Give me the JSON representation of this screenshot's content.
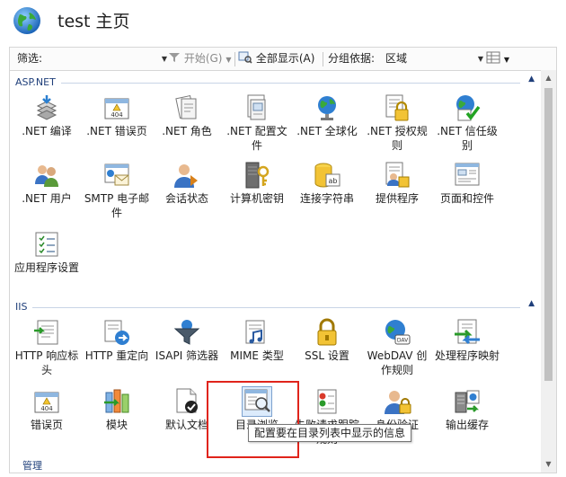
{
  "title": "test 主页",
  "filter": {
    "label": "筛选:",
    "value": "",
    "start_label": "开始(G)",
    "show_all_label": "全部显示(A)",
    "group_by_label": "分组依据:",
    "group_by_value": "区域"
  },
  "groups": [
    {
      "name": "ASP.NET",
      "items": [
        {
          "label": ".NET 编译",
          "icon": "compile-icon"
        },
        {
          "label": ".NET 错误页",
          "icon": "error-page-404-icon"
        },
        {
          "label": ".NET 角色",
          "icon": "roles-icon"
        },
        {
          "label": ".NET 配置文件",
          "icon": "profile-icon"
        },
        {
          "label": ".NET 全球化",
          "icon": "globalization-icon"
        },
        {
          "label": ".NET 授权规则",
          "icon": "authorization-lock-icon"
        },
        {
          "label": ".NET 信任级别",
          "icon": "trust-level-icon"
        },
        {
          "label": ".NET 用户",
          "icon": "users-icon"
        },
        {
          "label": "SMTP 电子邮件",
          "icon": "smtp-email-icon"
        },
        {
          "label": "会话状态",
          "icon": "session-state-icon"
        },
        {
          "label": "计算机密钥",
          "icon": "machine-key-icon"
        },
        {
          "label": "连接字符串",
          "icon": "connection-string-icon"
        },
        {
          "label": "提供程序",
          "icon": "providers-icon"
        },
        {
          "label": "页面和控件",
          "icon": "pages-controls-icon"
        },
        {
          "label": "应用程序设置",
          "icon": "app-settings-icon"
        }
      ]
    },
    {
      "name": "IIS",
      "items": [
        {
          "label": "HTTP 响应标头",
          "icon": "http-response-headers-icon"
        },
        {
          "label": "HTTP 重定向",
          "icon": "http-redirect-icon"
        },
        {
          "label": "ISAPI 筛选器",
          "icon": "isapi-filter-icon"
        },
        {
          "label": "MIME 类型",
          "icon": "mime-types-icon"
        },
        {
          "label": "SSL 设置",
          "icon": "ssl-lock-icon"
        },
        {
          "label": "WebDAV 创作规则",
          "icon": "webdav-icon"
        },
        {
          "label": "处理程序映射",
          "icon": "handler-mappings-icon"
        },
        {
          "label": "错误页",
          "icon": "error-page-404-icon"
        },
        {
          "label": "模块",
          "icon": "modules-icon"
        },
        {
          "label": "默认文档",
          "icon": "default-document-icon"
        },
        {
          "label": "目录浏览",
          "icon": "directory-browsing-icon"
        },
        {
          "label": "失败请求跟踪规则",
          "icon": "failed-request-tracing-icon"
        },
        {
          "label": "身份验证",
          "icon": "authentication-icon"
        },
        {
          "label": "输出缓存",
          "icon": "output-cache-icon"
        }
      ]
    }
  ],
  "tooltip": "配置要在目录列表中显示的信息",
  "next_group_partial": "管理",
  "colors": {
    "highlight": "#e0241b",
    "group_title": "#1f3f7a"
  }
}
